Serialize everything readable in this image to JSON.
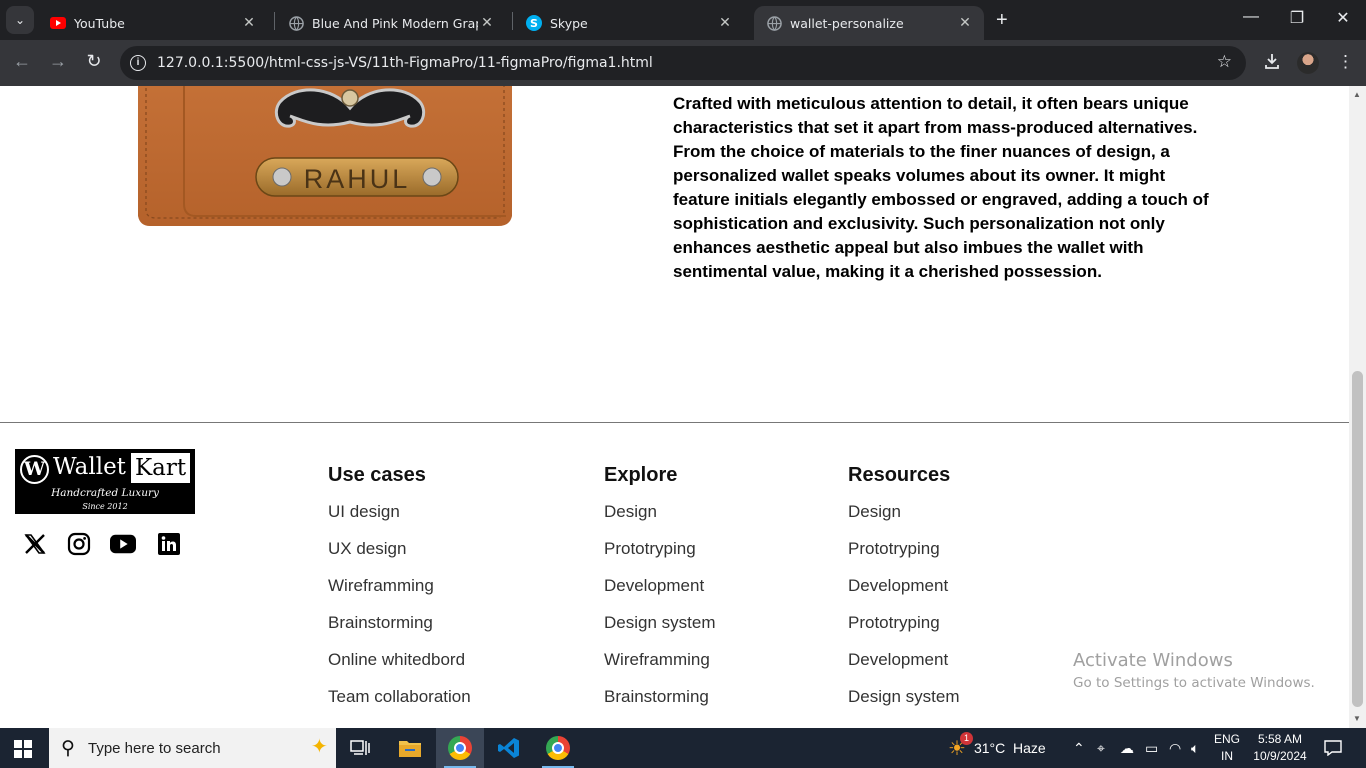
{
  "browser": {
    "tabs": [
      {
        "title": "YouTube",
        "icon": "youtube-icon",
        "active": false
      },
      {
        "title": "Blue And Pink Modern Graphic",
        "icon": "globe-icon",
        "active": false
      },
      {
        "title": "Skype",
        "icon": "skype-icon",
        "active": false
      },
      {
        "title": "wallet-personalize",
        "icon": "globe-icon",
        "active": true
      }
    ],
    "url": "127.0.0.1:5500/html-css-js-VS/11th-FigmaPro/11-figmaPro/figma1.html"
  },
  "product": {
    "badge_name": "RAHUL",
    "description": "Crafted with meticulous attention to detail, it often bears unique characteristics that set it apart from mass-produced alternatives. From the choice of materials to the finer nuances of design, a personalized wallet speaks volumes about its owner. It might feature initials elegantly embossed or engraved, adding a touch of sophistication and exclusivity. Such personalization not only enhances aesthetic appeal but also imbues the wallet with sentimental value, making it a cherished possession."
  },
  "footer": {
    "logo": {
      "word1": "Wallet",
      "word2": "Kart",
      "tagline": "Handcrafted Luxury",
      "since": "Since 2012"
    },
    "social": [
      "x-icon",
      "instagram-icon",
      "youtube-icon",
      "linkedin-icon"
    ],
    "columns": [
      {
        "title": "Use cases",
        "links": [
          "UI design",
          "UX design",
          "Wireframming",
          "Brainstorming",
          "Online whitedbord",
          "Team collaboration"
        ]
      },
      {
        "title": "Explore",
        "links": [
          "Design",
          "Prototryping",
          "Development",
          "Design system",
          "Wireframming",
          "Brainstorming"
        ]
      },
      {
        "title": "Resources",
        "links": [
          "Design",
          "Prototryping",
          "Development",
          "Prototryping",
          "Development",
          "Design system"
        ]
      }
    ]
  },
  "watermark": {
    "line1": "Activate Windows",
    "line2": "Go to Settings to activate Windows."
  },
  "taskbar": {
    "search_placeholder": "Type here to search",
    "weather": "31°C  Haze",
    "weather_badge": "1",
    "lang": "ENG",
    "region": "IN",
    "time": "5:58 AM",
    "date": "10/9/2024"
  }
}
